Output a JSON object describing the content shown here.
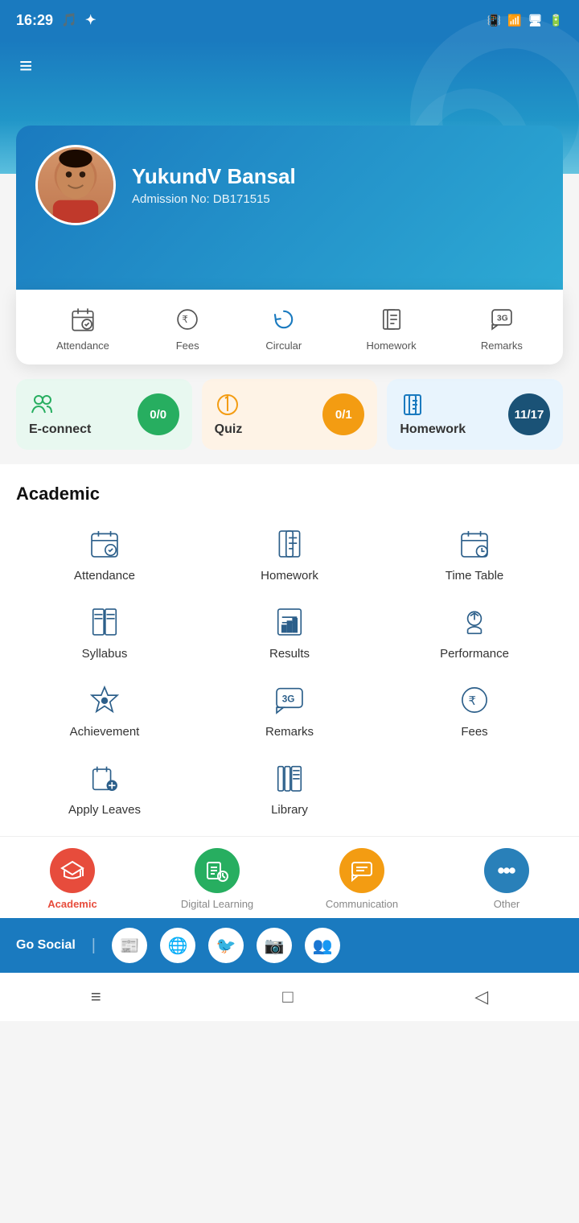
{
  "statusBar": {
    "time": "16:29",
    "icons": [
      "vibrate",
      "wifi",
      "screen-rotate",
      "battery"
    ]
  },
  "header": {
    "menuIcon": "≡"
  },
  "profile": {
    "name": "YukundV Bansal",
    "admissionLabel": "Admission No:",
    "admissionNo": "DB171515"
  },
  "quickMenu": [
    {
      "id": "attendance",
      "label": "Attendance",
      "icon": "📅"
    },
    {
      "id": "fees",
      "label": "Fees",
      "icon": "💰"
    },
    {
      "id": "circular",
      "label": "Circular",
      "icon": "🔄"
    },
    {
      "id": "homework",
      "label": "Homework",
      "icon": "📖"
    },
    {
      "id": "remarks",
      "label": "Remarks",
      "icon": "💬"
    }
  ],
  "stats": [
    {
      "id": "econnect",
      "label": "E-connect",
      "badge": "0/0",
      "badgeClass": "badge-green",
      "cardClass": "green"
    },
    {
      "id": "quiz",
      "label": "Quiz",
      "badge": "0/1",
      "badgeClass": "badge-orange",
      "cardClass": "orange"
    },
    {
      "id": "homework",
      "label": "Homework",
      "badge": "11/17",
      "badgeClass": "badge-dark-blue",
      "cardClass": "blue"
    }
  ],
  "academic": {
    "title": "Academic",
    "items": [
      {
        "id": "attendance",
        "label": "Attendance"
      },
      {
        "id": "homework",
        "label": "Homework"
      },
      {
        "id": "timetable",
        "label": "Time Table"
      },
      {
        "id": "syllabus",
        "label": "Syllabus"
      },
      {
        "id": "results",
        "label": "Results"
      },
      {
        "id": "performance",
        "label": "Performance"
      },
      {
        "id": "achievement",
        "label": "Achievement"
      },
      {
        "id": "remarks",
        "label": "Remarks"
      },
      {
        "id": "fees",
        "label": "Fees"
      },
      {
        "id": "applyleaves",
        "label": "Apply Leaves"
      },
      {
        "id": "library",
        "label": "Library"
      }
    ]
  },
  "bottomNav": [
    {
      "id": "academic",
      "label": "Academic",
      "active": true,
      "color": "red"
    },
    {
      "id": "digitallearning",
      "label": "Digital Learning",
      "active": false,
      "color": "green"
    },
    {
      "id": "communication",
      "label": "Communication",
      "active": false,
      "color": "yellow"
    },
    {
      "id": "other",
      "label": "Other",
      "active": false,
      "color": "blue-dark"
    }
  ],
  "goSocial": {
    "label": "Go Social",
    "divider": "|",
    "icons": [
      "newspaper",
      "globe",
      "twitter",
      "instagram",
      "user-group"
    ]
  },
  "androidNav": {
    "back": "◁",
    "home": "□",
    "menu": "≡"
  }
}
